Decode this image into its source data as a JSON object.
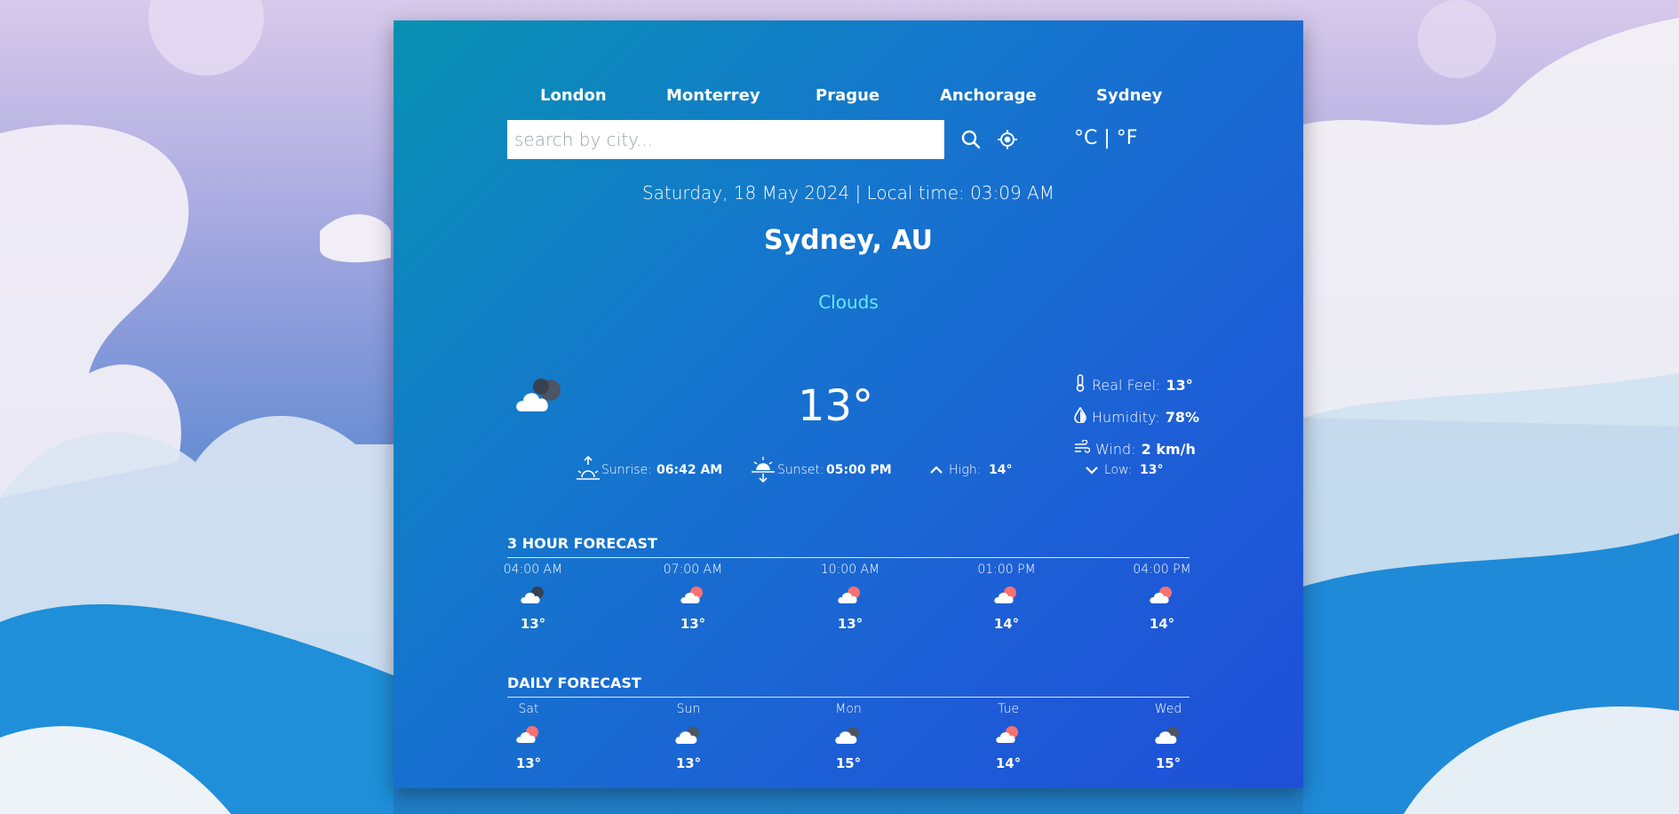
{
  "nav": {
    "cities": [
      "London",
      "Monterrey",
      "Prague",
      "Anchorage",
      "Sydney"
    ]
  },
  "search": {
    "placeholder": "search by city...",
    "value": "",
    "search_icon": "search-icon",
    "location_icon": "location-icon"
  },
  "units": {
    "celsius": "°C",
    "separator": "|",
    "fahrenheit": "°F"
  },
  "current": {
    "datetime": "Saturday, 18 May 2024 | Local time: 03:09 AM",
    "location": "Sydney, AU",
    "condition": "Clouds",
    "temperature": "13°",
    "icon": "cloudy-icon",
    "details": {
      "real_feel_label": "Real Feel:",
      "real_feel": "13°",
      "humidity_label": "Humidity:",
      "humidity": "78%",
      "wind_label": "Wind:",
      "wind": "2 km/h"
    },
    "sun": {
      "sunrise_label": "Sunrise:",
      "sunrise": "06:42 AM",
      "sunset_label": "Sunset:",
      "sunset": "05:00 PM",
      "high_label": "High:",
      "high": "14°",
      "low_label": "Low:",
      "low": "13°"
    }
  },
  "hourly": {
    "title": "3 HOUR FORECAST",
    "items": [
      {
        "label": "04:00 AM",
        "temp": "13°",
        "icon": "cloudy-night-icon"
      },
      {
        "label": "07:00 AM",
        "temp": "13°",
        "icon": "partly-cloudy-icon"
      },
      {
        "label": "10:00 AM",
        "temp": "13°",
        "icon": "partly-cloudy-icon"
      },
      {
        "label": "01:00 PM",
        "temp": "14°",
        "icon": "partly-cloudy-icon"
      },
      {
        "label": "04:00 PM",
        "temp": "14°",
        "icon": "partly-cloudy-icon"
      }
    ]
  },
  "daily": {
    "title": "DAILY FORECAST",
    "items": [
      {
        "label": "Sat",
        "temp": "13°",
        "icon": "partly-cloudy-icon"
      },
      {
        "label": "Sun",
        "temp": "13°",
        "icon": "cloudy-icon"
      },
      {
        "label": "Mon",
        "temp": "15°",
        "icon": "cloudy-icon"
      },
      {
        "label": "Tue",
        "temp": "14°",
        "icon": "partly-cloudy-icon"
      },
      {
        "label": "Wed",
        "temp": "15°",
        "icon": "cloudy-icon"
      }
    ]
  },
  "colors": {
    "card_start": "#0891b2",
    "card_end": "#1e4fd8",
    "condition_text": "#67e8f9",
    "sun_accent": "#f87171"
  }
}
